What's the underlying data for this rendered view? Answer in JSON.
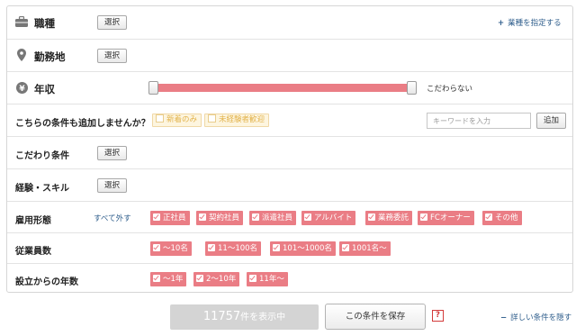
{
  "rows": {
    "job_type": {
      "label": "職種",
      "select_label": "選択",
      "link_label": "業種を指定する",
      "link_prefix": "+"
    },
    "location": {
      "label": "勤務地",
      "select_label": "選択"
    },
    "salary": {
      "label": "年収",
      "max_text": "こだわらない",
      "range_fill_percent": 100
    },
    "extra": {
      "label": "こちらの条件も追加しませんか？",
      "chips": [
        {
          "label": "新着のみ",
          "checked": false
        },
        {
          "label": "未経験者歓迎",
          "checked": false
        }
      ],
      "keyword_placeholder": "キーワードを入力",
      "add_label": "追加"
    },
    "preference": {
      "label": "こだわり条件",
      "select_label": "選択"
    },
    "experience": {
      "label": "経験・スキル",
      "select_label": "選択"
    },
    "employment": {
      "label": "雇用形態",
      "remove_all_label": "すべて外す",
      "tags": [
        "正社員",
        "契約社員",
        "派遣社員",
        "アルバイト",
        "業務委託",
        "FCオーナー",
        "その他"
      ]
    },
    "employees": {
      "label": "従業員数",
      "tags": [
        "〜10名",
        "11〜100名",
        "101〜1000名",
        "1001名〜"
      ]
    },
    "years": {
      "label": "設立からの年数",
      "tags": [
        "〜1年",
        "2〜10年",
        "11年〜"
      ]
    }
  },
  "footer": {
    "count_number": "11757",
    "count_suffix": "件を表示中",
    "save_label": "この条件を保存",
    "help_label": "?",
    "hide_label": "詳しい条件を隠す",
    "hide_prefix": "−"
  },
  "colors": {
    "accent": "#ea7d85",
    "link": "#2f5e8c",
    "chip": "#fdf5df",
    "disabled": "#d4d4d4"
  },
  "icons": {
    "job_type": "briefcase-icon",
    "location": "map-pin-icon",
    "salary": "yen-icon"
  }
}
